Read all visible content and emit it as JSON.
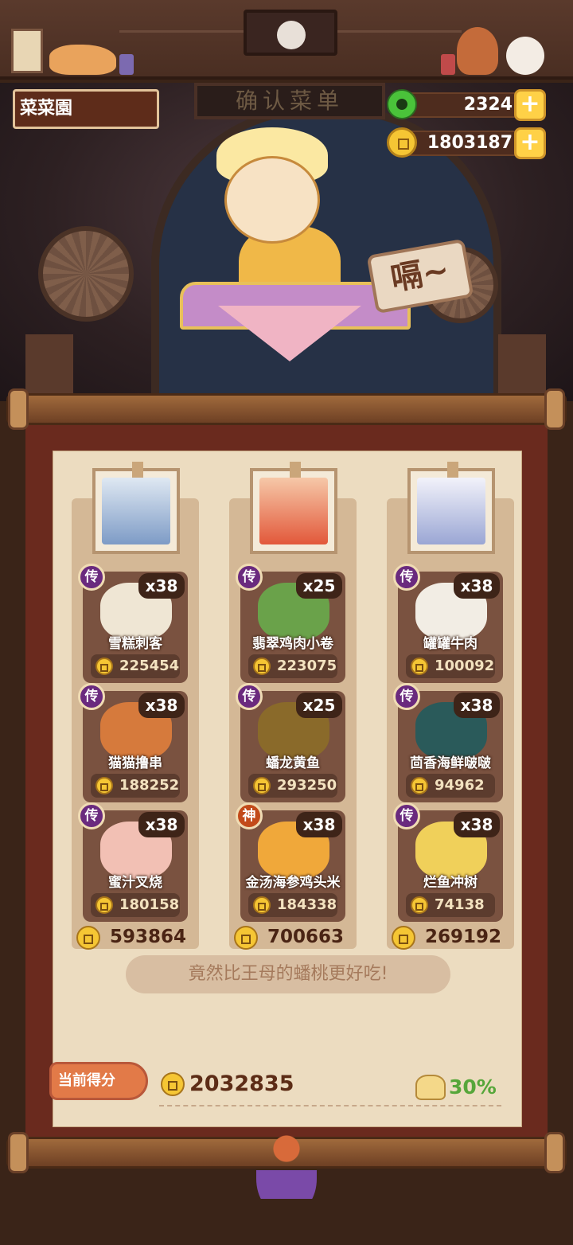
{
  "player": {
    "name": "菜菜園"
  },
  "currency": {
    "jade": "2324",
    "gold": "1803187",
    "plus_label": "+"
  },
  "scene": {
    "signboard": "确认菜单",
    "speech": "嗝~"
  },
  "colors": {
    "legend_badge": "#6a2a7e",
    "god_badge": "#c24a1a",
    "bonus_green": "#56a63a",
    "score_tag": "#e27a48"
  },
  "columns": [
    {
      "dishes": [
        {
          "badge": "传",
          "qty": "x38",
          "name": "雪糕刺客",
          "price": "225454"
        },
        {
          "badge": "传",
          "qty": "x38",
          "name": "猫猫撸串",
          "price": "188252"
        },
        {
          "badge": "传",
          "qty": "x38",
          "name": "蜜汁叉烧",
          "price": "180158"
        }
      ],
      "total": "593864"
    },
    {
      "dishes": [
        {
          "badge": "传",
          "qty": "x25",
          "name": "翡翠鸡肉小卷",
          "price": "223075"
        },
        {
          "badge": "传",
          "qty": "x25",
          "name": "蟠龙黄鱼",
          "price": "293250"
        },
        {
          "badge": "神",
          "qty": "x38",
          "name": "金汤海参鸡头米",
          "price": "184338"
        }
      ],
      "total": "700663"
    },
    {
      "dishes": [
        {
          "badge": "传",
          "qty": "x38",
          "name": "罐罐牛肉",
          "price": "100092"
        },
        {
          "badge": "传",
          "qty": "x38",
          "name": "茴香海鲜啵啵",
          "price": "94962"
        },
        {
          "badge": "传",
          "qty": "x38",
          "name": "烂鱼冲树",
          "price": "74138"
        }
      ],
      "total": "269192"
    }
  ],
  "comment": "竟然比王母的蟠桃更好吃!",
  "score": {
    "label": "当前得分",
    "value": "2032835",
    "bonus": "30%"
  }
}
